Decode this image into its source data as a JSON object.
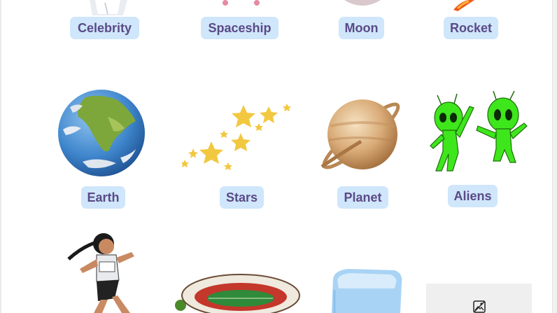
{
  "cards": [
    {
      "label": "Celebrity",
      "image": "celebrity-image"
    },
    {
      "label": "Spaceship",
      "image": "spaceship-image"
    },
    {
      "label": "Moon",
      "image": "moon-image"
    },
    {
      "label": "Rocket",
      "image": "rocket-image"
    },
    {
      "label": "Earth",
      "image": "earth-image"
    },
    {
      "label": "Stars",
      "image": "stars-image"
    },
    {
      "label": "Planet",
      "image": "planet-image"
    },
    {
      "label": "Aliens",
      "image": "aliens-image"
    },
    {
      "label": "",
      "image": "runner-image"
    },
    {
      "label": "",
      "image": "stadium-image"
    },
    {
      "label": "",
      "image": "ice-cube-image"
    },
    {
      "label": "",
      "image": "broken-image-icon"
    }
  ],
  "colors": {
    "label_bg": "#cfe6fb",
    "label_text": "#5a4a86",
    "alien_green": "#3ee61c"
  }
}
